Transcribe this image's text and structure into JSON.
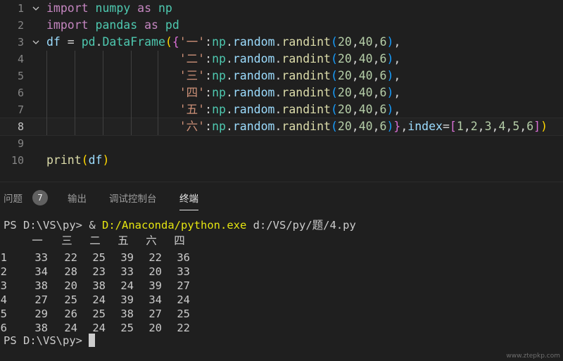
{
  "editor": {
    "lines": [
      {
        "n": "1",
        "tokens": [
          [
            "kw",
            "import"
          ],
          [
            "pu",
            " "
          ],
          [
            "cl",
            "numpy"
          ],
          [
            "pu",
            " "
          ],
          [
            "kw",
            "as"
          ],
          [
            "pu",
            " "
          ],
          [
            "cl",
            "np"
          ]
        ]
      },
      {
        "n": "2",
        "tokens": [
          [
            "kw",
            "import"
          ],
          [
            "pu",
            " "
          ],
          [
            "cl",
            "pandas"
          ],
          [
            "pu",
            " "
          ],
          [
            "kw",
            "as"
          ],
          [
            "pu",
            " "
          ],
          [
            "cl",
            "pd"
          ]
        ]
      },
      {
        "n": "3",
        "tokens": [
          [
            "vr",
            "df"
          ],
          [
            "pu",
            " = "
          ],
          [
            "cl",
            "pd"
          ],
          [
            "pu",
            "."
          ],
          [
            "cl",
            "DataFrame"
          ],
          [
            "br1",
            "("
          ],
          [
            "br2",
            "{"
          ],
          [
            "str",
            "'一'"
          ],
          [
            "pu",
            ":"
          ],
          [
            "cl",
            "np"
          ],
          [
            "pu",
            "."
          ],
          [
            "vr",
            "random"
          ],
          [
            "pu",
            "."
          ],
          [
            "fn",
            "randint"
          ],
          [
            "br3",
            "("
          ],
          [
            "num",
            "20"
          ],
          [
            "pu",
            ","
          ],
          [
            "num",
            "40"
          ],
          [
            "pu",
            ","
          ],
          [
            "num",
            "6"
          ],
          [
            "br3",
            ")"
          ],
          [
            "pu",
            ","
          ]
        ]
      },
      {
        "n": "4",
        "tokens": [
          [
            "pu",
            "                   "
          ],
          [
            "str",
            "'二'"
          ],
          [
            "pu",
            ":"
          ],
          [
            "cl",
            "np"
          ],
          [
            "pu",
            "."
          ],
          [
            "vr",
            "random"
          ],
          [
            "pu",
            "."
          ],
          [
            "fn",
            "randint"
          ],
          [
            "br3",
            "("
          ],
          [
            "num",
            "20"
          ],
          [
            "pu",
            ","
          ],
          [
            "num",
            "40"
          ],
          [
            "pu",
            ","
          ],
          [
            "num",
            "6"
          ],
          [
            "br3",
            ")"
          ],
          [
            "pu",
            ","
          ]
        ]
      },
      {
        "n": "5",
        "tokens": [
          [
            "pu",
            "                   "
          ],
          [
            "str",
            "'三'"
          ],
          [
            "pu",
            ":"
          ],
          [
            "cl",
            "np"
          ],
          [
            "pu",
            "."
          ],
          [
            "vr",
            "random"
          ],
          [
            "pu",
            "."
          ],
          [
            "fn",
            "randint"
          ],
          [
            "br3",
            "("
          ],
          [
            "num",
            "20"
          ],
          [
            "pu",
            ","
          ],
          [
            "num",
            "40"
          ],
          [
            "pu",
            ","
          ],
          [
            "num",
            "6"
          ],
          [
            "br3",
            ")"
          ],
          [
            "pu",
            ","
          ]
        ]
      },
      {
        "n": "6",
        "tokens": [
          [
            "pu",
            "                   "
          ],
          [
            "str",
            "'四'"
          ],
          [
            "pu",
            ":"
          ],
          [
            "cl",
            "np"
          ],
          [
            "pu",
            "."
          ],
          [
            "vr",
            "random"
          ],
          [
            "pu",
            "."
          ],
          [
            "fn",
            "randint"
          ],
          [
            "br3",
            "("
          ],
          [
            "num",
            "20"
          ],
          [
            "pu",
            ","
          ],
          [
            "num",
            "40"
          ],
          [
            "pu",
            ","
          ],
          [
            "num",
            "6"
          ],
          [
            "br3",
            ")"
          ],
          [
            "pu",
            ","
          ]
        ]
      },
      {
        "n": "7",
        "tokens": [
          [
            "pu",
            "                   "
          ],
          [
            "str",
            "'五'"
          ],
          [
            "pu",
            ":"
          ],
          [
            "cl",
            "np"
          ],
          [
            "pu",
            "."
          ],
          [
            "vr",
            "random"
          ],
          [
            "pu",
            "."
          ],
          [
            "fn",
            "randint"
          ],
          [
            "br3",
            "("
          ],
          [
            "num",
            "20"
          ],
          [
            "pu",
            ","
          ],
          [
            "num",
            "40"
          ],
          [
            "pu",
            ","
          ],
          [
            "num",
            "6"
          ],
          [
            "br3",
            ")"
          ],
          [
            "pu",
            ","
          ]
        ]
      },
      {
        "n": "8",
        "tokens": [
          [
            "pu",
            "                   "
          ],
          [
            "str",
            "'六'"
          ],
          [
            "pu",
            ":"
          ],
          [
            "cl",
            "np"
          ],
          [
            "pu",
            "."
          ],
          [
            "vr",
            "random"
          ],
          [
            "pu",
            "."
          ],
          [
            "fn",
            "randint"
          ],
          [
            "br3",
            "("
          ],
          [
            "num",
            "20"
          ],
          [
            "pu",
            ","
          ],
          [
            "num",
            "40"
          ],
          [
            "pu",
            ","
          ],
          [
            "num",
            "6"
          ],
          [
            "br3",
            ")"
          ],
          [
            "br2",
            "}"
          ],
          [
            "pu",
            ","
          ],
          [
            "vr",
            "index"
          ],
          [
            "pu",
            "="
          ],
          [
            "br2",
            "["
          ],
          [
            "num",
            "1"
          ],
          [
            "pu",
            ","
          ],
          [
            "num",
            "2"
          ],
          [
            "pu",
            ","
          ],
          [
            "num",
            "3"
          ],
          [
            "pu",
            ","
          ],
          [
            "num",
            "4"
          ],
          [
            "pu",
            ","
          ],
          [
            "num",
            "5"
          ],
          [
            "pu",
            ","
          ],
          [
            "num",
            "6"
          ],
          [
            "br2",
            "]"
          ],
          [
            "br1",
            ")"
          ]
        ]
      },
      {
        "n": "9",
        "tokens": []
      },
      {
        "n": "10",
        "tokens": [
          [
            "fn",
            "print"
          ],
          [
            "br1",
            "("
          ],
          [
            "vr",
            "df"
          ],
          [
            "br1",
            ")"
          ]
        ]
      }
    ],
    "active_line": "8",
    "fold_icon": "chevron-down-icon"
  },
  "panel": {
    "tabs": [
      {
        "label": "问题",
        "active": false
      },
      {
        "label": "输出",
        "active": false
      },
      {
        "label": "调试控制台",
        "active": false
      },
      {
        "label": "终端",
        "active": true
      }
    ],
    "problems_count": "7"
  },
  "terminal": {
    "prompt": "PS D:\\VS\\py>",
    "command_amp": "&",
    "command_exe": "D:/Anaconda/python.exe",
    "command_arg": "d:/VS/py/题/4.py",
    "headers": [
      "一",
      "三",
      "二",
      "五",
      "六",
      "四"
    ],
    "rows": [
      {
        "index": "1",
        "values": [
          "33",
          "22",
          "25",
          "39",
          "22",
          "36"
        ]
      },
      {
        "index": "2",
        "values": [
          "34",
          "28",
          "23",
          "33",
          "20",
          "33"
        ]
      },
      {
        "index": "3",
        "values": [
          "38",
          "20",
          "38",
          "24",
          "39",
          "27"
        ]
      },
      {
        "index": "4",
        "values": [
          "27",
          "25",
          "24",
          "39",
          "34",
          "24"
        ]
      },
      {
        "index": "5",
        "values": [
          "29",
          "26",
          "25",
          "38",
          "27",
          "25"
        ]
      },
      {
        "index": "6",
        "values": [
          "38",
          "24",
          "24",
          "25",
          "20",
          "22"
        ]
      }
    ],
    "final_prompt": "PS D:\\VS\\py>"
  },
  "watermark": "www.ztepkp.com"
}
